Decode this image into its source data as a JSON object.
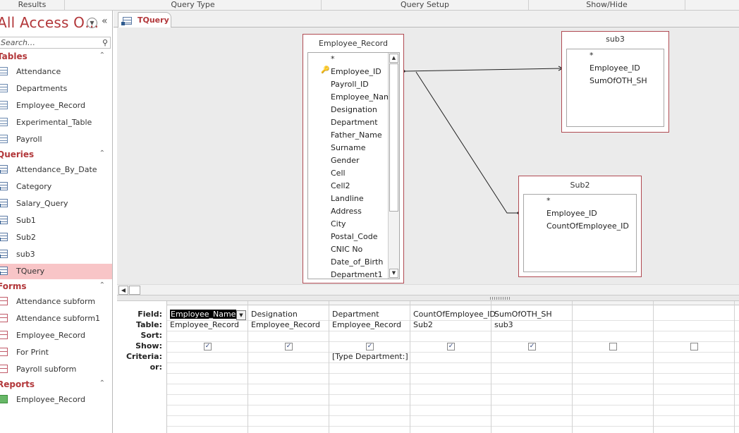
{
  "ribbon": {
    "groups": [
      "Results",
      "Query Type",
      "Query Setup",
      "Show/Hide"
    ]
  },
  "nav": {
    "title": "All Access O…",
    "search_placeholder": "Search…",
    "collapse_glyph": "«",
    "sections": [
      {
        "title": "Tables",
        "items": [
          "Attendance",
          "Departments",
          "Employee_Record",
          "Experimental_Table",
          "Payroll"
        ]
      },
      {
        "title": "Queries",
        "items": [
          "Attendance_By_Date",
          "Category",
          "Salary_Query",
          "Sub1",
          "Sub2",
          "sub3",
          "TQuery"
        ]
      },
      {
        "title": "Forms",
        "items": [
          "Attendance subform",
          "Attendance subform1",
          "Employee_Record",
          "For Print",
          "Payroll subform"
        ]
      },
      {
        "title": "Reports",
        "items": [
          "Employee_Record"
        ]
      }
    ],
    "selected": "TQuery"
  },
  "tab": {
    "label": "TQuery"
  },
  "tables": {
    "employee_record": {
      "title": "Employee_Record",
      "fields": [
        "*",
        "Employee_ID",
        "Payroll_ID",
        "Employee_Name",
        "Designation",
        "Department",
        "Father_Name",
        "Surname",
        "Gender",
        "Cell",
        "Cell2",
        "Landline",
        "Address",
        "City",
        "Postal_Code",
        "CNIC No",
        "Date_of_Birth",
        "Department1"
      ]
    },
    "sub3": {
      "title": "sub3",
      "fields": [
        "*",
        "Employee_ID",
        "SumOfOTH_SH"
      ]
    },
    "sub2": {
      "title": "Sub2",
      "fields": [
        "*",
        "Employee_ID",
        "CountOfEmployee_ID"
      ]
    }
  },
  "grid": {
    "row_labels": [
      "Field:",
      "Table:",
      "Sort:",
      "Show:",
      "Criteria:",
      "or:"
    ],
    "columns": [
      {
        "field": "Employee_Name",
        "table": "Employee_Record",
        "show": true,
        "criteria": ""
      },
      {
        "field": "Designation",
        "table": "Employee_Record",
        "show": true,
        "criteria": ""
      },
      {
        "field": "Department",
        "table": "Employee_Record",
        "show": true,
        "criteria": "[Type Department:]"
      },
      {
        "field": "CountOfEmployee_ID",
        "table": "Sub2",
        "show": true,
        "criteria": ""
      },
      {
        "field": "SumOfOTH_SH",
        "table": "sub3",
        "show": true,
        "criteria": ""
      },
      {
        "field": "",
        "table": "",
        "show": false,
        "criteria": ""
      },
      {
        "field": "",
        "table": "",
        "show": false,
        "criteria": ""
      }
    ]
  },
  "colors": {
    "accent": "#b2373a",
    "selected_bg": "#f8c5c7",
    "canvas": "#ebebeb",
    "table_border": "#b04a52"
  }
}
